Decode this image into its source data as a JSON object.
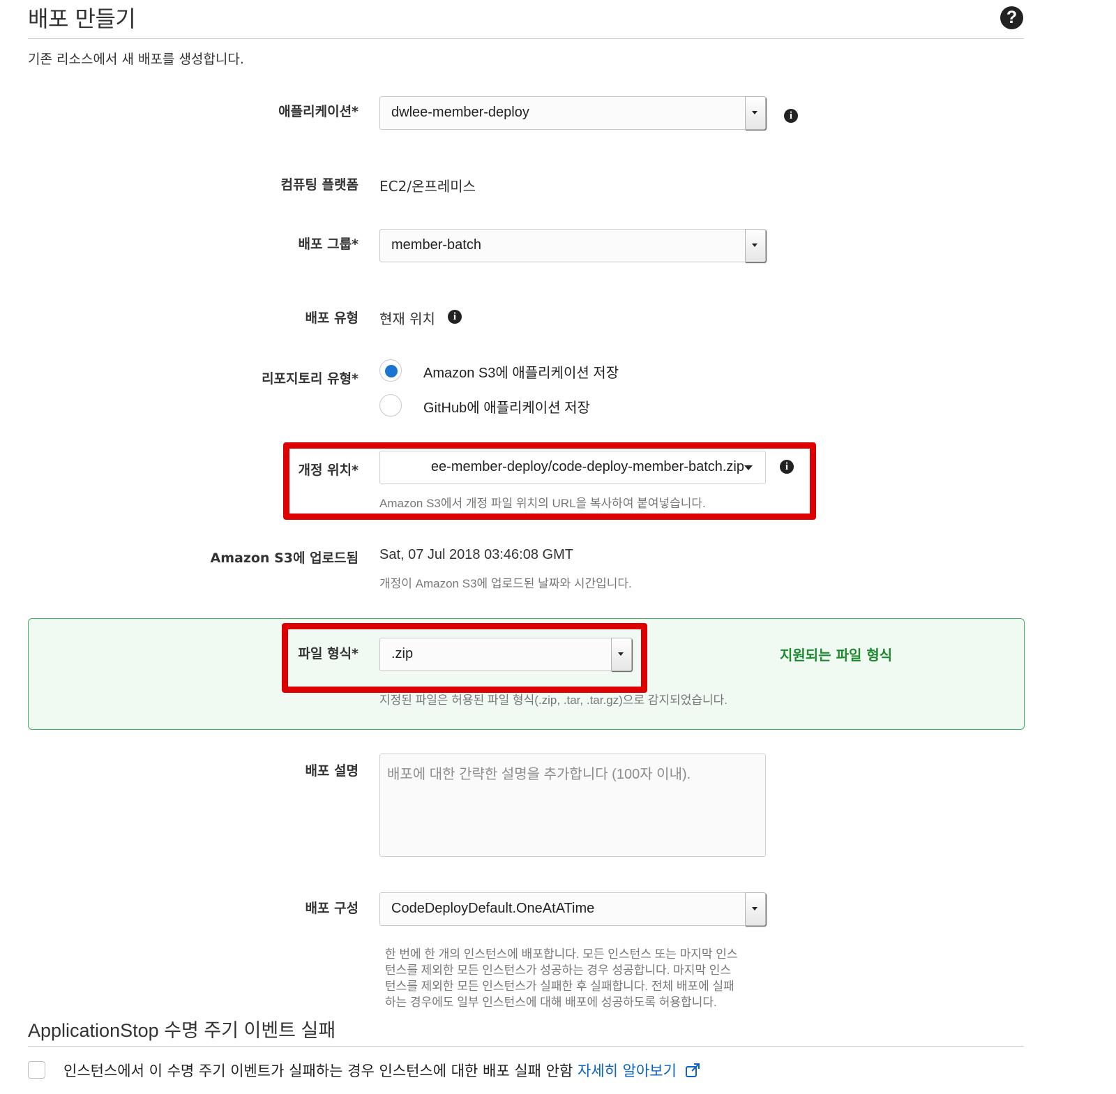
{
  "header": {
    "title": "배포 만들기",
    "help_icon": "?",
    "description": "기존 리소스에서 새 배포를 생성합니다."
  },
  "form": {
    "application": {
      "label": "애플리케이션*",
      "value": "dwlee-member-deploy"
    },
    "compute_platform": {
      "label": "컴퓨팅 플랫폼",
      "value": "EC2/온프레미스"
    },
    "deployment_group": {
      "label": "배포 그룹*",
      "value": "member-batch"
    },
    "deployment_type": {
      "label": "배포 유형",
      "value": "현재 위치"
    },
    "repository_type": {
      "label": "리포지토리 유형*",
      "options": [
        {
          "label": "Amazon S3에 애플리케이션 저장",
          "selected": true
        },
        {
          "label": "GitHub에 애플리케이션 저장",
          "selected": false
        }
      ]
    },
    "revision_location": {
      "label": "개정 위치*",
      "value": "ee-member-deploy/code-deploy-member-batch.zip",
      "hint": "Amazon S3에서 개정 파일 위치의 URL을 복사하여 붙여넣습니다."
    },
    "uploaded": {
      "label": "Amazon S3에 업로드됨",
      "value": "Sat, 07 Jul 2018 03:46:08 GMT",
      "hint": "개정이 Amazon S3에 업로드된 날짜와 시간입니다."
    },
    "file_type": {
      "label": "파일 형식*",
      "value": ".zip",
      "hint": "지정된 파일은 허용된 파일 형식(.zip, .tar, .tar.gz)으로 감지되었습니다.",
      "supported_title": "지원되는 파일 형식"
    },
    "description": {
      "label": "배포 설명",
      "placeholder": "배포에 대한 간략한 설명을 추가합니다 (100자 이내)."
    },
    "deployment_config": {
      "label": "배포 구성",
      "value": "CodeDeployDefault.OneAtATime",
      "desc_lines": [
        "한 번에 한 개의 인스턴스에 배포합니다. 모든 인스턴스 또는 마지막 인스",
        "턴스를 제외한 모든 인스턴스가 성공하는 경우 성공합니다. 마지막 인스",
        "턴스를 제외한 모든 인스턴스가 실패한 후 실패합니다. 전체 배포에 실패",
        "하는 경우에도 일부 인스턴스에 대해 배포에 성공하도록 허용합니다."
      ]
    }
  },
  "lifecycle": {
    "title": "ApplicationStop 수명 주기 이벤트 실패",
    "checkbox_label": "인스턴스에서 이 수명 주기 이벤트가 실패하는 경우 인스턴스에 대한 배포 실패 안함",
    "learn_more": "자세히 알아보기",
    "checked": false
  },
  "colors": {
    "highlight_border": "#dd0000",
    "panel_border": "#3db35b",
    "panel_title": "#1d8a30",
    "link": "#0b63c5",
    "radio_selected": "#1a74d0"
  },
  "icons": [
    "help-icon",
    "info-icon",
    "dropdown-arrow-icon",
    "external-link-icon"
  ]
}
